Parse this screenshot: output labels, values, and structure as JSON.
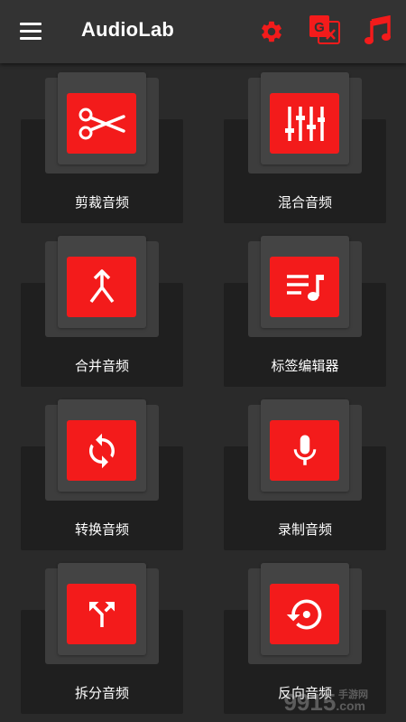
{
  "app": {
    "title": "AudioLab"
  },
  "toolbar": {
    "menu_icon": "hamburger-menu-icon",
    "settings_icon": "gear-icon",
    "translate_icon": "google-translate-icon",
    "translate_glyph": "G",
    "music_icon": "music-note-icon"
  },
  "colors": {
    "accent": "#f31b1b",
    "appbar": "#333333",
    "background": "#2a2a2a",
    "card": "#1f1f1f"
  },
  "tiles": [
    {
      "label": "剪裁音频",
      "icon": "scissors-icon"
    },
    {
      "label": "混合音频",
      "icon": "equalizer-sliders-icon"
    },
    {
      "label": "合并音频",
      "icon": "merge-arrow-icon"
    },
    {
      "label": "标签编辑器",
      "icon": "playlist-note-icon"
    },
    {
      "label": "转换音频",
      "icon": "sync-arrows-icon"
    },
    {
      "label": "录制音频",
      "icon": "microphone-icon"
    },
    {
      "label": "拆分音频",
      "icon": "split-arrow-icon"
    },
    {
      "label": "反向音频",
      "icon": "reverse-clock-icon"
    }
  ],
  "watermark": {
    "text_main": "9915",
    "text_domain": ".com",
    "text_cn": "手游网"
  }
}
